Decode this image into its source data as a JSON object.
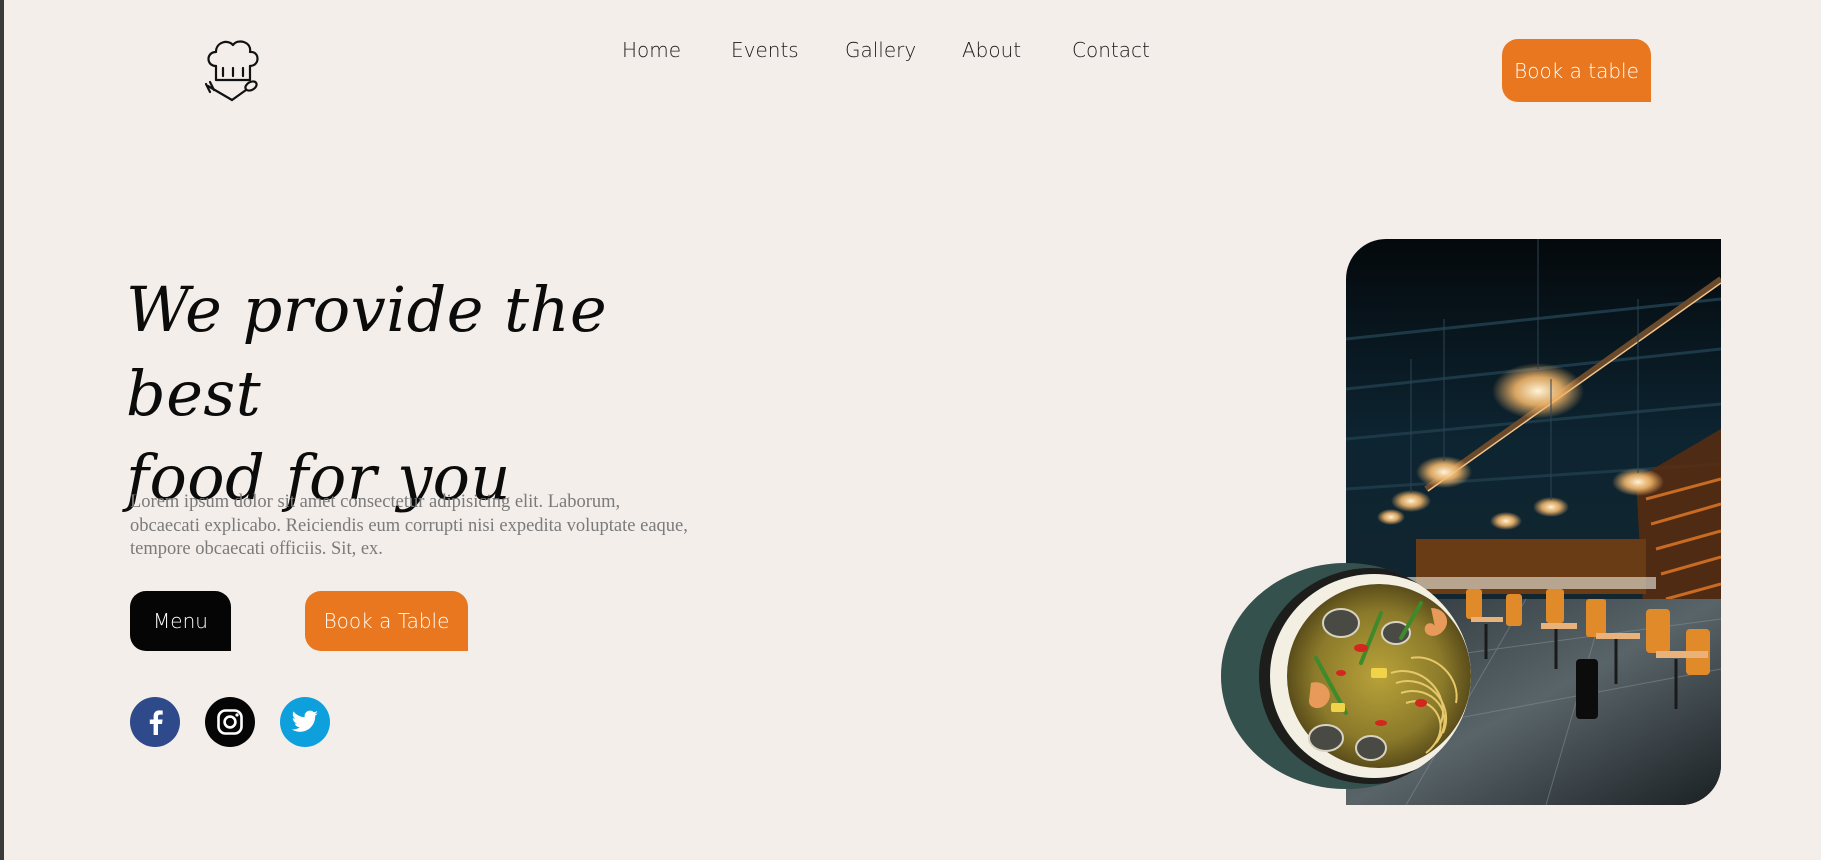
{
  "brand": {
    "logo_icon": "chef-hat-icon"
  },
  "nav": {
    "items": [
      {
        "label": "Home"
      },
      {
        "label": "Events"
      },
      {
        "label": "Gallery"
      },
      {
        "label": "About"
      },
      {
        "label": "Contact"
      }
    ]
  },
  "header": {
    "book_label": "Book a table"
  },
  "hero": {
    "title_line1": "We provide the best",
    "title_line2": "food for you",
    "description": "Lorem ipsum dolor sit amet consectetur adipisicing elit. Laborum, obcaecati explicabo. Reiciendis eum corrupti nisi expedita voluptate eaque, tempore obcaecati officiis. Sit, ex.",
    "menu_label": "Menu",
    "book_label": "Book a Table"
  },
  "social": [
    {
      "icon": "facebook-icon",
      "color": "#2f4a8a"
    },
    {
      "icon": "instagram-icon",
      "color": "#050505"
    },
    {
      "icon": "twitter-icon",
      "color": "#0ea0dc"
    }
  ],
  "colors": {
    "accent": "#e8771f",
    "background": "#f3eeea",
    "dark": "#050505"
  },
  "images": {
    "restaurant": "restaurant-interior-image",
    "food": "noodle-soup-bowl-image"
  }
}
